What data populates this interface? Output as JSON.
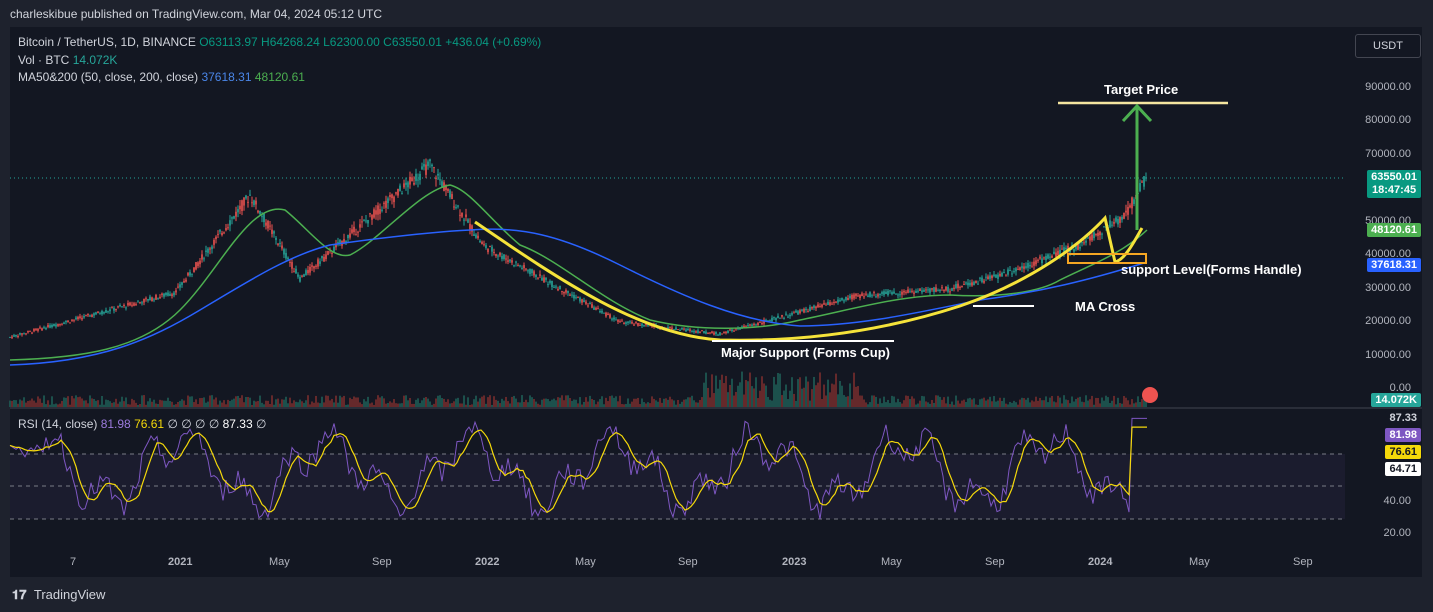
{
  "publisher_line": "charleskibue published on TradingView.com, Mar 04, 2024 05:12 UTC",
  "legend": {
    "symbol": "Bitcoin / TetherUS, 1D, BINANCE",
    "ohlc": {
      "o": "O63113.97",
      "h": "H64268.24",
      "l": "L62300.00",
      "c": "C63550.01",
      "chg": "+436.04 (+0.69%)"
    },
    "vol_label": "Vol · BTC",
    "vol_value": "14.072K",
    "ma_label": "MA50&200 (50, close, 200, close)",
    "ma50_value": "37618.31",
    "ma200_value": "48120.61",
    "rsi_label": "RSI (14, close)",
    "rsi_value": "81.98",
    "rsi_ma_value": "76.61",
    "rsi_extra": "∅ ∅ ∅ ∅",
    "rsi_upper": "87.33",
    "rsi_tail": "∅"
  },
  "currency_button": "USDT",
  "price_axis": {
    "ticks": [
      {
        "label": "90000.00",
        "value": 90000
      },
      {
        "label": "80000.00",
        "value": 80000
      },
      {
        "label": "70000.00",
        "value": 70000
      },
      {
        "label": "50000.00",
        "value": 50000
      },
      {
        "label": "40000.00",
        "value": 40000
      },
      {
        "label": "30000.00",
        "value": 30000
      },
      {
        "label": "20000.00",
        "value": 20000
      },
      {
        "label": "10000.00",
        "value": 10000
      },
      {
        "label": "0.00",
        "value": 0
      }
    ]
  },
  "badges": {
    "last_price": "63550.01",
    "countdown": "18:47:45",
    "ma200_badge": "48120.61",
    "ma50_badge": "37618.31",
    "volume_badge": "14.072K",
    "rsi_max": "87.33",
    "rsi_val": "81.98",
    "rsi_ma": "76.61",
    "rsi_min": "64.71"
  },
  "rsi_axis": {
    "ticks": [
      {
        "label": "40.00",
        "value": 40
      },
      {
        "label": "20.00",
        "value": 20
      }
    ]
  },
  "time_axis": {
    "labels": [
      "7",
      "2021",
      "May",
      "Sep",
      "2022",
      "May",
      "Sep",
      "2023",
      "May",
      "Sep",
      "2024",
      "May",
      "Sep"
    ]
  },
  "annotations": {
    "target_price": "Target Price",
    "support_level": "support Level(Forms Handle)",
    "ma_cross": "MA Cross",
    "major_support": "Major Support (Forms Cup)"
  },
  "footer": {
    "brand": "TradingView",
    "icon": "tradingview-logo-icon"
  },
  "colors": {
    "background": "#131722",
    "up": "#26a69a",
    "down": "#ef5350",
    "ma50": "#2962ff",
    "ma200": "#4caf50",
    "cup_line": "#f5e33a",
    "target_arrow": "#4caf50",
    "rsi": "#7e57c2",
    "rsi_ma": "#f5d90a"
  },
  "chart_data": {
    "type": "line",
    "title": "Bitcoin / TetherUS, 1D, BINANCE",
    "x": [
      "2020-11",
      "2021-01",
      "2021-04",
      "2021-07",
      "2021-11",
      "2022-01",
      "2022-06",
      "2022-11",
      "2023-03",
      "2023-07",
      "2023-10",
      "2024-01",
      "2024-02",
      "2024-03"
    ],
    "series": [
      {
        "name": "BTC/USDT close",
        "values": [
          15500,
          29000,
          58000,
          33000,
          67000,
          43000,
          20000,
          16500,
          28000,
          30000,
          34000,
          43000,
          52000,
          63550
        ]
      }
    ],
    "ylim": [
      0,
      95000
    ],
    "last_close": 63550.01,
    "ma50_last": 48120.61,
    "ma200_last": 37618.31,
    "rsi_last": 81.98,
    "rsi_ma_last": 76.61,
    "annotations": [
      "Target Price",
      "support Level(Forms Handle)",
      "MA Cross",
      "Major Support (Forms Cup)"
    ],
    "grid": false
  }
}
